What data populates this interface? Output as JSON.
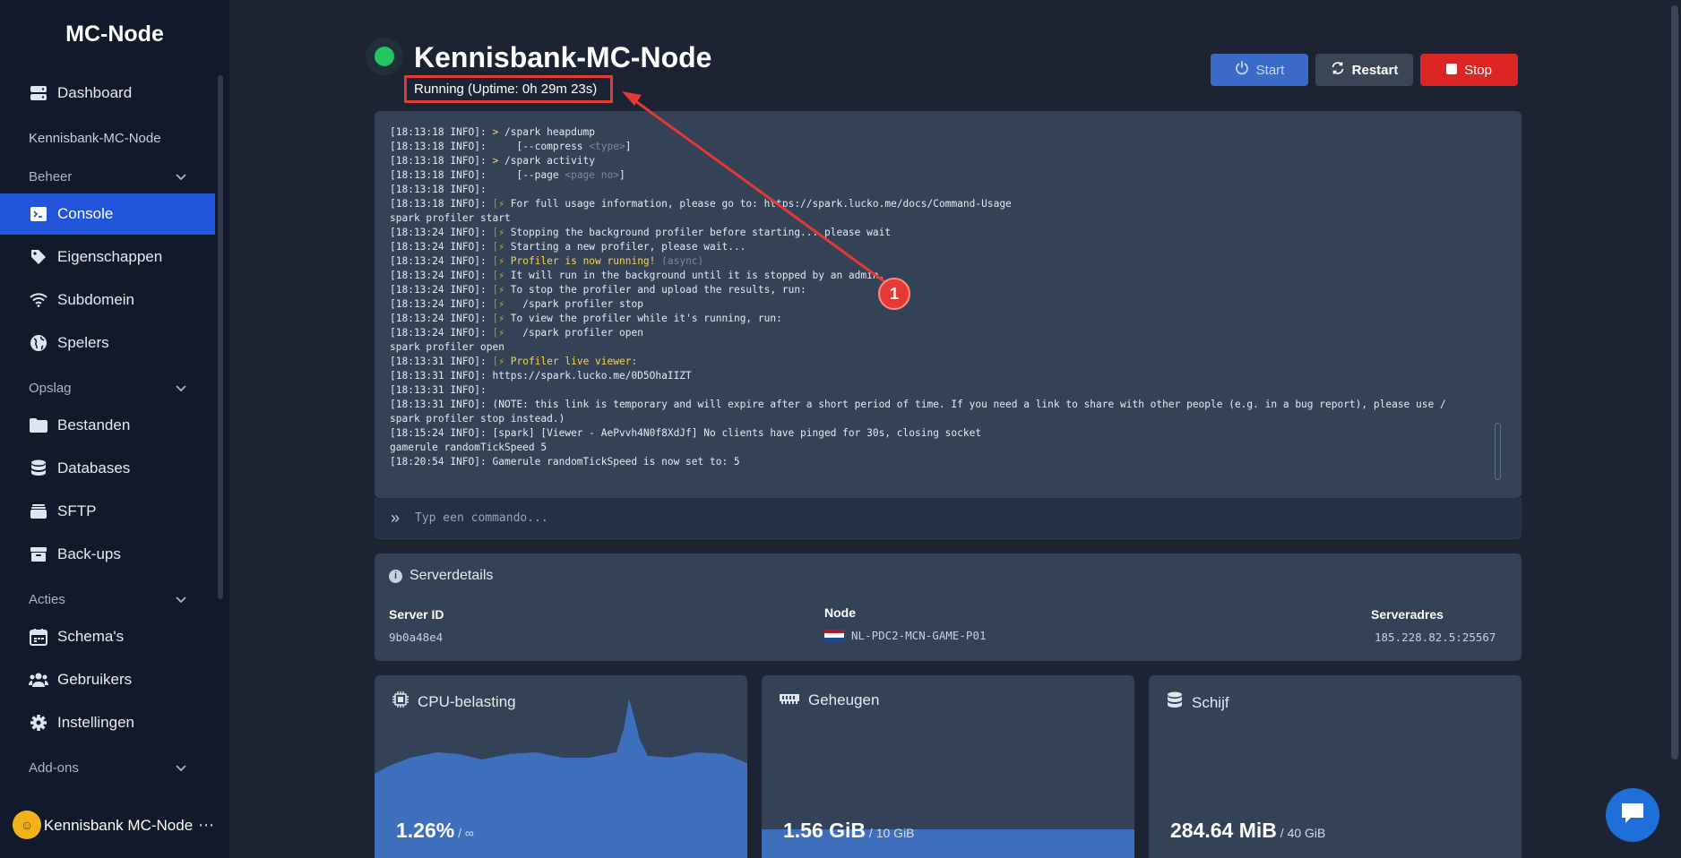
{
  "sidebar": {
    "logo": "MC-Node",
    "dashboard": "Dashboard",
    "server_name": "Kennisbank-MC-Node",
    "section_beheer": "Beheer",
    "console": "Console",
    "eigenschappen": "Eigenschappen",
    "subdomein": "Subdomein",
    "spelers": "Spelers",
    "section_opslag": "Opslag",
    "bestanden": "Bestanden",
    "databases": "Databases",
    "sftp": "SFTP",
    "backups": "Back-ups",
    "section_acties": "Acties",
    "schemas": "Schema's",
    "gebruikers": "Gebruikers",
    "instellingen": "Instellingen",
    "section_addons": "Add-ons",
    "user_name": "Kennisbank MC-Node"
  },
  "header": {
    "title": "Kennisbank-MC-Node",
    "status": "Running (Uptime: 0h 29m 23s)",
    "start_label": "Start",
    "restart_label": "Restart",
    "stop_label": "Stop"
  },
  "console": {
    "lines": [
      [
        [
          "[18:13:18 INFO]: ",
          ""
        ],
        [
          "> ",
          "yl"
        ],
        [
          "/spark heapdump",
          ""
        ]
      ],
      [
        [
          "[18:13:18 INFO]:     ",
          ""
        ],
        [
          "[--compress ",
          ""
        ],
        [
          "<type>",
          "dim"
        ],
        [
          "]",
          ""
        ]
      ],
      [
        [
          "[18:13:18 INFO]: ",
          ""
        ],
        [
          "> ",
          "yl"
        ],
        [
          "/spark activity",
          ""
        ]
      ],
      [
        [
          "[18:13:18 INFO]:     ",
          ""
        ],
        [
          "[--page ",
          ""
        ],
        [
          "<page no>",
          "dim"
        ],
        [
          "]",
          ""
        ]
      ],
      [
        [
          "[18:13:18 INFO]:",
          ""
        ]
      ],
      [
        [
          "[18:13:18 INFO]: ",
          ""
        ],
        [
          "[",
          "dim"
        ],
        [
          "⚡",
          "bolt"
        ],
        [
          " For full usage information, please go to: https://spark.lucko.me/docs/Command-Usage",
          ""
        ]
      ],
      [
        [
          "spark profiler start",
          ""
        ]
      ],
      [
        [
          "[18:13:24 INFO]: ",
          ""
        ],
        [
          "[",
          "dim"
        ],
        [
          "⚡",
          "bolt"
        ],
        [
          " Stopping the background profiler before starting... please wait",
          ""
        ]
      ],
      [
        [
          "[18:13:24 INFO]: ",
          ""
        ],
        [
          "[",
          "dim"
        ],
        [
          "⚡",
          "bolt"
        ],
        [
          " Starting a new profiler, please wait...",
          ""
        ]
      ],
      [
        [
          "[18:13:24 INFO]: ",
          ""
        ],
        [
          "[",
          "dim"
        ],
        [
          "⚡",
          "bolt"
        ],
        [
          " Profiler is now running!",
          "yl"
        ],
        [
          " (async)",
          "dim"
        ]
      ],
      [
        [
          "[18:13:24 INFO]: ",
          ""
        ],
        [
          "[",
          "dim"
        ],
        [
          "⚡",
          "bolt"
        ],
        [
          " It will run in the background until it is stopped by an admin.",
          ""
        ]
      ],
      [
        [
          "[18:13:24 INFO]: ",
          ""
        ],
        [
          "[",
          "dim"
        ],
        [
          "⚡",
          "bolt"
        ],
        [
          " To stop the profiler and upload the results, run:",
          ""
        ]
      ],
      [
        [
          "[18:13:24 INFO]: ",
          ""
        ],
        [
          "[",
          "dim"
        ],
        [
          "⚡",
          "bolt"
        ],
        [
          "   /spark profiler stop",
          ""
        ]
      ],
      [
        [
          "[18:13:24 INFO]: ",
          ""
        ],
        [
          "[",
          "dim"
        ],
        [
          "⚡",
          "bolt"
        ],
        [
          " To view the profiler while it's running, run:",
          ""
        ]
      ],
      [
        [
          "[18:13:24 INFO]: ",
          ""
        ],
        [
          "[",
          "dim"
        ],
        [
          "⚡",
          "bolt"
        ],
        [
          "   /spark profiler open",
          ""
        ]
      ],
      [
        [
          "spark profiler open",
          ""
        ]
      ],
      [
        [
          "[18:13:31 INFO]: ",
          ""
        ],
        [
          "[",
          "dim"
        ],
        [
          "⚡",
          "bolt"
        ],
        [
          " Profiler live viewer:",
          "yl"
        ]
      ],
      [
        [
          "[18:13:31 INFO]: https://spark.lucko.me/0D5OhaIIZT",
          ""
        ]
      ],
      [
        [
          "[18:13:31 INFO]:",
          ""
        ]
      ],
      [
        [
          "[18:13:31 INFO]: (NOTE: this link is temporary and will expire after a short period of time. If you need a link to share with other people (e.g. in a bug report), please use /",
          ""
        ]
      ],
      [
        [
          "spark profiler stop instead.)",
          ""
        ]
      ],
      [
        [
          "[18:15:24 INFO]: [spark] [Viewer - AePvvh4N0f8XdJf] No clients have pinged for 30s, closing socket",
          ""
        ]
      ],
      [
        [
          "gamerule randomTickSpeed 5",
          ""
        ]
      ],
      [
        [
          "[18:20:54 INFO]: Gamerule randomTickSpeed is now set to: 5",
          ""
        ]
      ]
    ],
    "input_placeholder": "Typ een commando..."
  },
  "details": {
    "title": "Serverdetails",
    "server_id_label": "Server ID",
    "server_id": "9b0a48e4",
    "node_label": "Node",
    "node": "NL-PDC2-MCN-GAME-P01",
    "address_label": "Serveradres",
    "address": "185.228.82.5:25567"
  },
  "stats": {
    "cpu_title": "CPU-belasting",
    "cpu_value": "1.26%",
    "cpu_limit": " / ∞",
    "mem_title": "Geheugen",
    "mem_value": "1.56 GiB",
    "mem_limit": " / 10 GiB",
    "mem_used_fraction": 0.156,
    "disk_title": "Schijf",
    "disk_value": "284.64 MiB",
    "disk_limit": " / 40 GiB"
  },
  "annotation": {
    "badge": "1"
  },
  "colors": {
    "accent": "#2255d9",
    "running": "#22c55e",
    "stop": "#dc2626",
    "annotation": "#e53935"
  }
}
